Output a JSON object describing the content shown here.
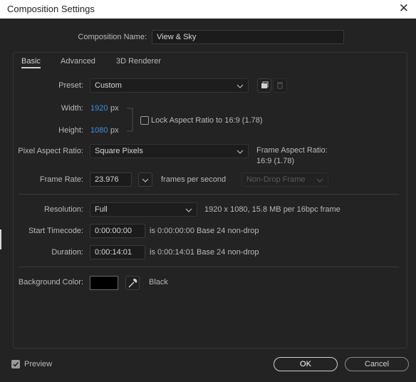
{
  "window": {
    "title": "Composition Settings",
    "close_glyph": "✕"
  },
  "comp_name": {
    "label": "Composition Name:",
    "value": "View & Sky"
  },
  "tabs": [
    {
      "label": "Basic",
      "active": true
    },
    {
      "label": "Advanced",
      "active": false
    },
    {
      "label": "3D Renderer",
      "active": false
    }
  ],
  "preset": {
    "label": "Preset:",
    "value": "Custom"
  },
  "width": {
    "label": "Width:",
    "value": "1920",
    "unit": "px"
  },
  "height": {
    "label": "Height:",
    "value": "1080",
    "unit": "px"
  },
  "lock_aspect": {
    "label": "Lock Aspect Ratio to 16:9 (1.78)",
    "checked": false
  },
  "pixel_aspect": {
    "label": "Pixel Aspect Ratio:",
    "value": "Square Pixels"
  },
  "frame_aspect": {
    "label": "Frame Aspect Ratio:",
    "value": "16:9 (1.78)"
  },
  "frame_rate": {
    "label": "Frame Rate:",
    "value": "23.976",
    "unit": "frames per second",
    "drop_frame": "Non-Drop Frame"
  },
  "resolution": {
    "label": "Resolution:",
    "value": "Full",
    "info": "1920 x 1080, 15.8 MB per 16bpc frame"
  },
  "start_timecode": {
    "label": "Start Timecode:",
    "value": "0:00:00:00",
    "info": "is 0:00:00:00  Base 24  non-drop"
  },
  "duration": {
    "label": "Duration:",
    "value": "0:00:14:01",
    "info": "is 0:00:14:01  Base 24  non-drop"
  },
  "background": {
    "label": "Background Color:",
    "color": "#000000",
    "name": "Black"
  },
  "preview": {
    "label": "Preview",
    "checked": true
  },
  "buttons": {
    "ok": "OK",
    "cancel": "Cancel"
  },
  "colors": {
    "accent_blue": "#3f8fe0",
    "background": "#232323"
  }
}
